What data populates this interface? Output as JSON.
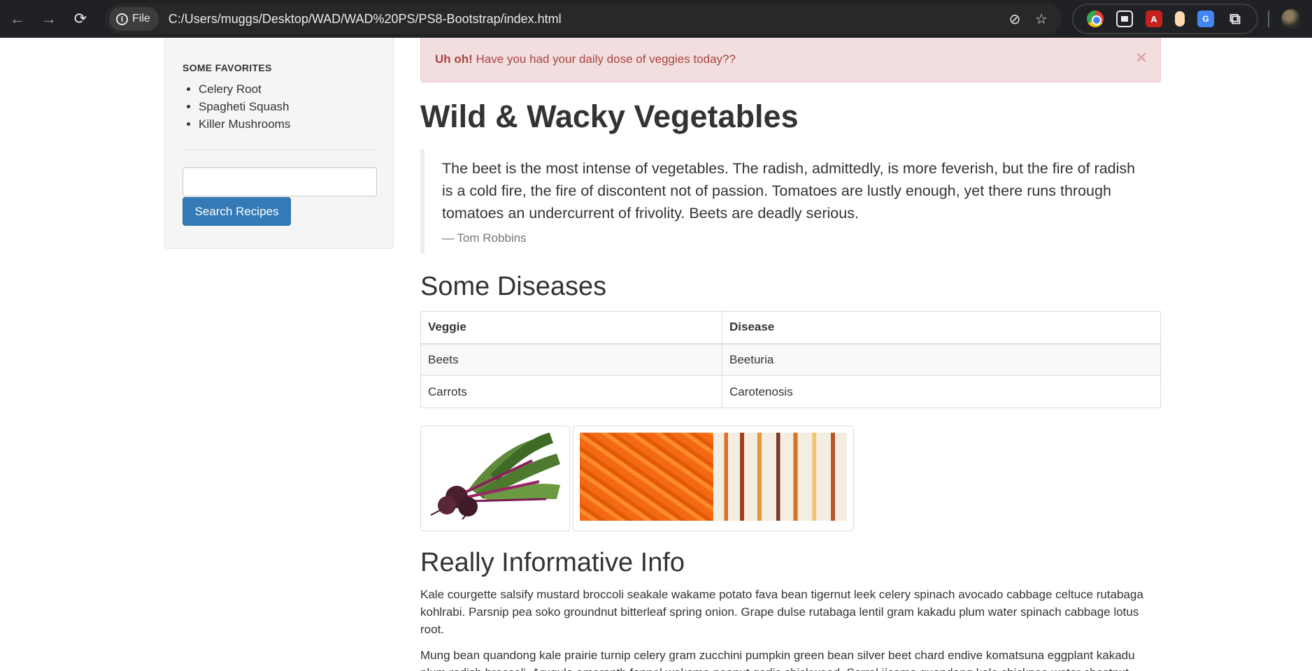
{
  "browser": {
    "chip_label": "File",
    "url": "C:/Users/muggs/Desktop/WAD/WAD%20PS/PS8-Bootstrap/index.html",
    "back_icon": "←",
    "forward_icon": "→",
    "reload_icon": "⟳",
    "star_icon": "☆",
    "eye_off_icon": "⊘",
    "pdf_ext_label": "A",
    "translate_ext_label": "G",
    "puzzle_icon": "⧉"
  },
  "sidebar": {
    "heading": "SOME FAVORITES",
    "items": [
      "Celery Root",
      "Spagheti Squash",
      "Killer Mushrooms"
    ],
    "search_value": "",
    "search_button": "Search Recipes"
  },
  "alert": {
    "strong": "Uh oh!",
    "message": " Have you had your daily dose of veggies today??",
    "close": "×"
  },
  "main": {
    "title": "Wild & Wacky Vegetables",
    "quote": {
      "text": "The beet is the most intense of vegetables. The radish, admittedly, is more feverish, but the fire of radish is a cold fire, the fire of discontent not of passion. Tomatoes are lustly enough, yet there runs through tomatoes an undercurrent of frivolity. Beets are deadly serious.",
      "author": "— Tom Robbins"
    },
    "diseases_title": "Some Diseases",
    "table": {
      "headers": [
        "Veggie",
        "Disease"
      ],
      "rows": [
        [
          "Beets",
          "Beeturia"
        ],
        [
          "Carrots",
          "Carotenosis"
        ]
      ]
    },
    "info_title": "Really Informative Info",
    "paragraphs": [
      "Kale courgette salsify mustard broccoli seakale wakame potato fava bean tigernut leek celery spinach avocado cabbage celtuce rutabaga kohlrabi. Parsnip pea soko groundnut bitterleaf spring onion. Grape dulse rutabaga lentil gram kakadu plum water spinach cabbage lotus root.",
      "Mung bean quandong kale prairie turnip celery gram zucchini pumpkin green bean silver beet chard endive komatsuna eggplant kakadu plum radish broccoli. Arugula amaranth fennel wakame peanut garlic chickweed. Sorrel jícama quandong kale chickpea water chestnut"
    ]
  },
  "colors": {
    "primary": "#337ab7",
    "alert_bg": "#f2dede",
    "alert_text": "#a94442",
    "well_bg": "#f5f5f5"
  }
}
